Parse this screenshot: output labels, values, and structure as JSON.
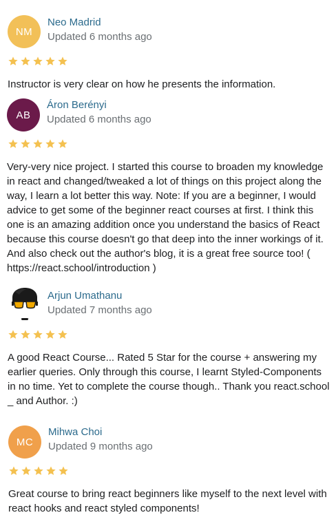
{
  "colors": {
    "name_link": "#2b6a8c",
    "meta": "#6a6f73",
    "star": "#f4c150",
    "text": "#1c1d1f"
  },
  "reviews": [
    {
      "initials": "NM",
      "avatar_color": "#f2c058",
      "name": "Neo Madrid",
      "updated": "Updated 6 months ago",
      "rating": 5,
      "text": "Instructor is very clear on how he presents the information."
    },
    {
      "initials": "AB",
      "avatar_color": "#6b1a4a",
      "name": "Áron Berényi",
      "updated": "Updated 6 months ago",
      "rating": 5,
      "text": "Very-very nice project. I started this course to broaden my knowledge in react and changed/tweaked a lot of things on this project along the way, I learn a lot better this way. Note: If you are a beginner, I would advice to get some of the beginner react courses at first. I think this one is an amazing addition once you understand the basics of React because this course doesn't go that deep into the inner workings of it. And also check out the author's blog, it is a great free source too! ( https://react.school/introduction )"
    },
    {
      "initials": "",
      "avatar_icon": "cartoon-face-with-sunglasses-icon",
      "name": "Arjun Umathanu",
      "updated": "Updated 7 months ago",
      "rating": 5,
      "text": "A good React Course... Rated 5 Star for the course + answering my earlier queries. Only through this course, I learnt Styled-Components in no time. Yet to complete the course though.. Thank you react.school _ and Author. :)"
    },
    {
      "initials": "MC",
      "avatar_color": "#f0a04b",
      "name": "Mihwa Choi",
      "updated": "Updated 9 months ago",
      "rating": 5,
      "text": "Great course to bring react beginners like myself to the next level with react hooks and react styled components!"
    }
  ]
}
